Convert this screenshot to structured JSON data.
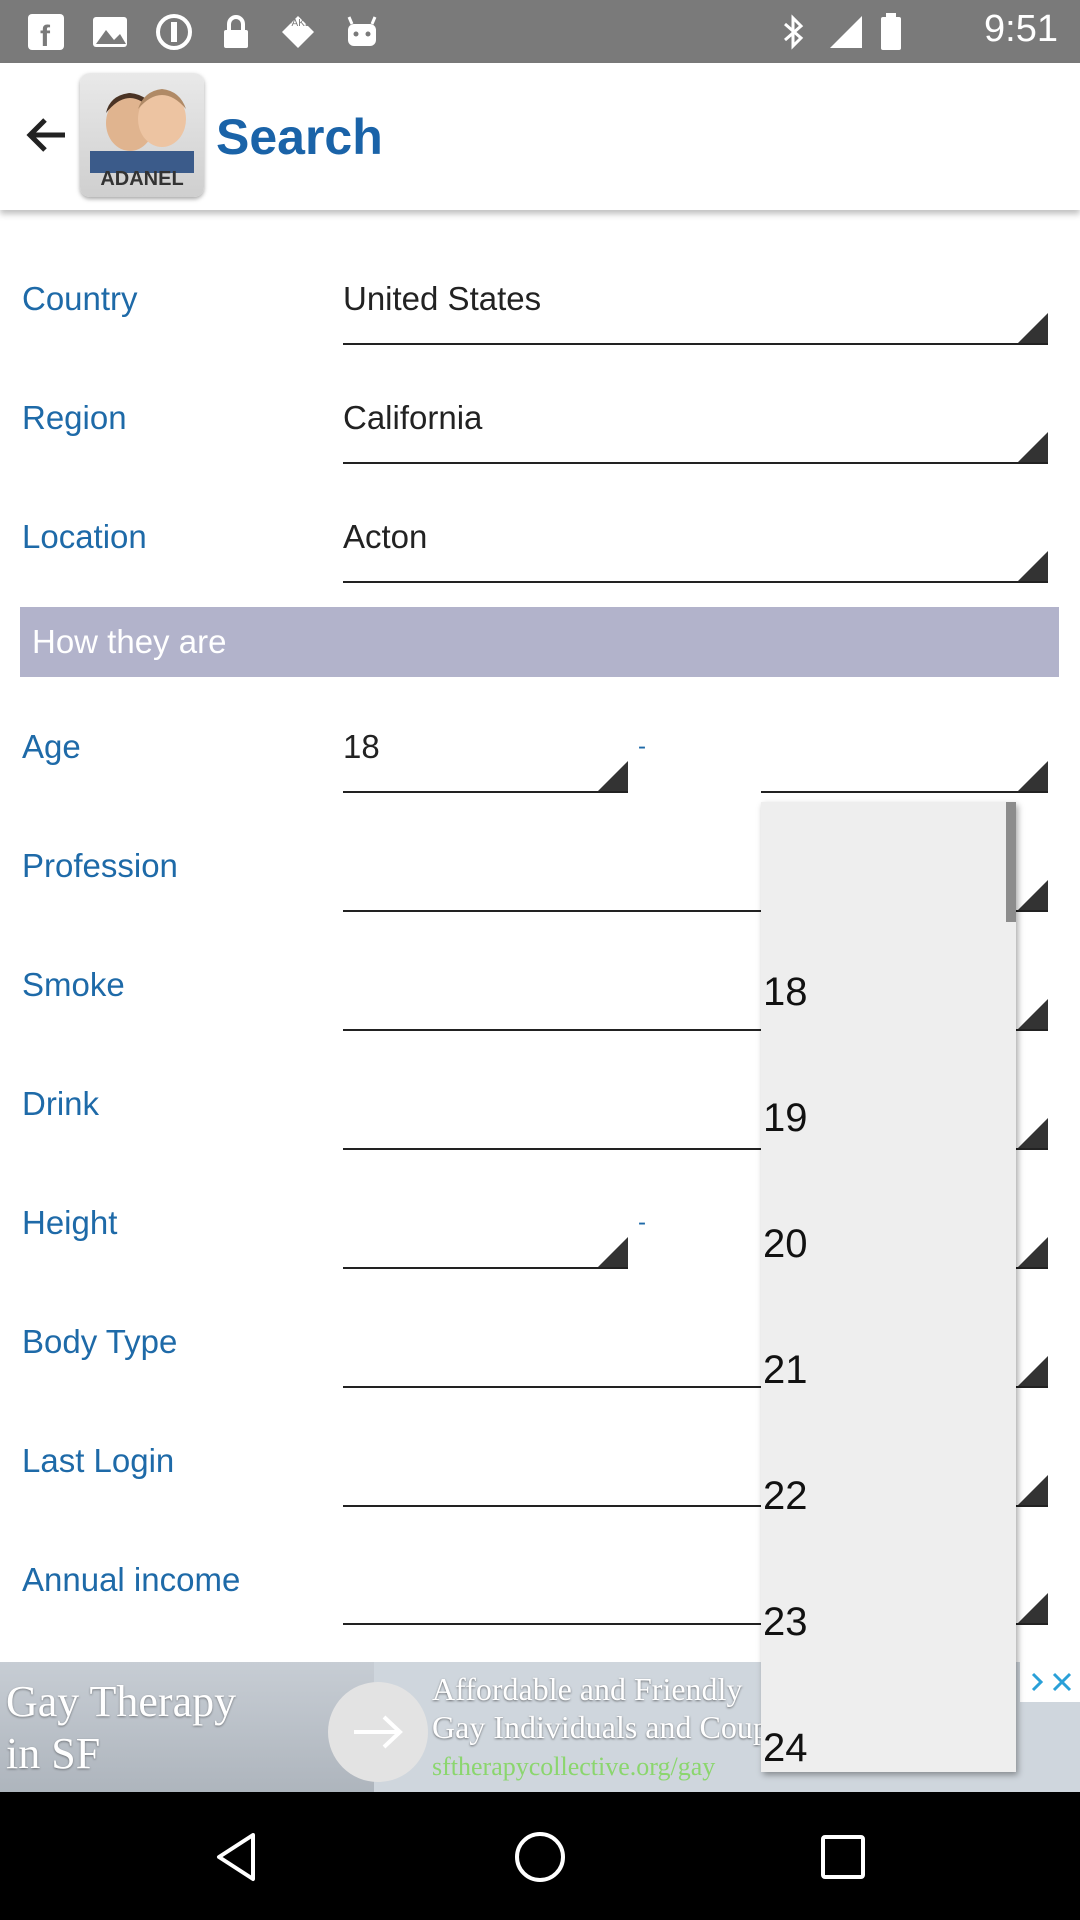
{
  "status_bar": {
    "time": "9:51",
    "icons": [
      "facebook-icon",
      "photo-icon",
      "data-saver-icon",
      "lock-icon",
      "fake-gps-icon",
      "android-icon",
      "bluetooth-icon",
      "signal-icon",
      "battery-icon"
    ]
  },
  "app_bar": {
    "title": "Search",
    "logo_text": "ADANEL"
  },
  "fields": [
    {
      "label": "Country",
      "value": "United States"
    },
    {
      "label": "Region",
      "value": "California"
    },
    {
      "label": "Location",
      "value": "Acton"
    }
  ],
  "section": {
    "title": "How they are"
  },
  "age": {
    "label": "Age",
    "from": "18",
    "separator": "-",
    "to": ""
  },
  "attributes": [
    {
      "label": "Profession",
      "value": ""
    },
    {
      "label": "Smoke",
      "value": ""
    },
    {
      "label": "Drink",
      "value": ""
    }
  ],
  "height": {
    "label": "Height",
    "separator": "-"
  },
  "attributes2": [
    {
      "label": "Body Type",
      "value": ""
    },
    {
      "label": "Last Login",
      "value": ""
    },
    {
      "label": "Annual income",
      "value": ""
    }
  ],
  "dropdown": {
    "options": [
      "18",
      "19",
      "20",
      "21",
      "22",
      "23",
      "24"
    ]
  },
  "ad": {
    "headline_line1": "Gay Therapy",
    "headline_line2": "in SF",
    "body_line1": "Affordable and Friendly",
    "body_line2": "Gay Individuals and Couples",
    "url": "sftherapycollective.org/gay"
  },
  "colors": {
    "label_blue": "#1e6aa8",
    "title_blue": "#1a63a8",
    "section_bg": "#b2b3cb",
    "status_bg": "#7a7a7a"
  }
}
